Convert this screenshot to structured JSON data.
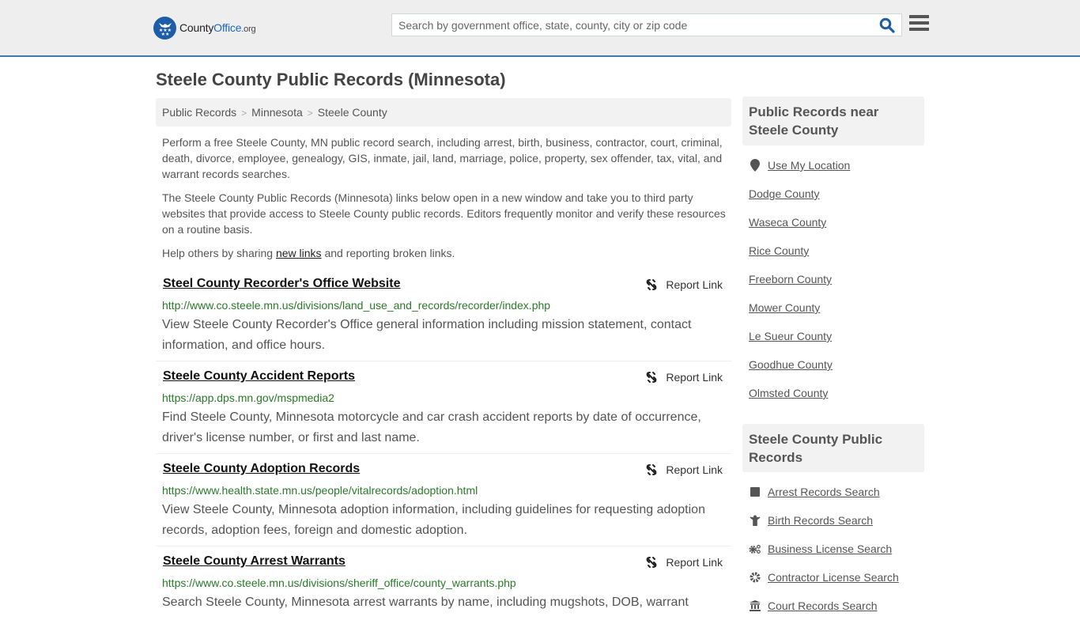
{
  "header": {
    "logo": {
      "part1": "County",
      "part2": "Office",
      "part3": ".org"
    },
    "search_placeholder": "Search by government office, state, county, city or zip code",
    "search_value": ""
  },
  "page": {
    "title": "Steele County Public Records (Minnesota)",
    "breadcrumb": [
      "Public Records",
      "Minnesota",
      "Steele County"
    ],
    "breadcrumb_separator": ">"
  },
  "intro": {
    "p1": "Perform a free Steele County, MN public record search, including arrest, birth, business, contractor, court, criminal, death, divorce, employee, genealogy, GIS, inmate, jail, land, marriage, police, property, sex offender, tax, vital, and warrant records searches.",
    "p2": "The Steele County Public Records (Minnesota) links below open in a new window and take you to third party websites that provide access to Steele County public records. Editors frequently monitor and verify these resources on a routine basis.",
    "p3_before": "Help others by sharing ",
    "p3_link": "new links",
    "p3_after": " and reporting broken links."
  },
  "records": [
    {
      "title": "Steel County Recorder's Office Website",
      "url": "http://www.co.steele.mn.us/divisions/land_use_and_records/recorder/index.php",
      "description": "View Steele County Recorder's Office general information including mission statement, contact information, and office hours.",
      "report_label": "Report Link"
    },
    {
      "title": "Steele County Accident Reports",
      "url": "https://app.dps.mn.gov/mspmedia2",
      "description": "Find Steele County, Minnesota motorcycle and car crash accident reports by date of occurrence, driver's license number, or first and last name.",
      "report_label": "Report Link"
    },
    {
      "title": "Steele County Adoption Records",
      "url": "https://www.health.state.mn.us/people/vitalrecords/adoption.html",
      "description": "View Steele County, Minnesota adoption information, including guidelines for requesting adoption records, adoption fees, foreign and domestic adoption.",
      "report_label": "Report Link"
    },
    {
      "title": "Steele County Arrest Warrants",
      "url": "https://www.co.steele.mn.us/divisions/sheriff_office/county_warrants.php",
      "description": "Search Steele County, Minnesota arrest warrants by name, including mugshots, DOB, warrant",
      "report_label": "Report Link"
    }
  ],
  "sidebar": {
    "nearby_title": "Public Records near Steele County",
    "use_location": "Use My Location",
    "nearby": [
      "Dodge County",
      "Waseca County",
      "Rice County",
      "Freeborn County",
      "Mower County",
      "Le Sueur County",
      "Goodhue County",
      "Olmsted County"
    ],
    "records_title": "Steele County Public Records",
    "record_links": [
      {
        "label": "Arrest Records Search",
        "icon": "square-icon"
      },
      {
        "label": "Birth Records Search",
        "icon": "child-icon"
      },
      {
        "label": "Business License Search",
        "icon": "cogs-icon"
      },
      {
        "label": "Contractor License Search",
        "icon": "gear-icon"
      },
      {
        "label": "Court Records Search",
        "icon": "courthouse-icon"
      }
    ]
  },
  "colors": {
    "header_bg": "#eeeeee",
    "header_border": "#3d79ac",
    "logo_blue": "#1c5ca8",
    "url_green": "#2a7a2a",
    "search_icon": "#1c5ca8"
  }
}
